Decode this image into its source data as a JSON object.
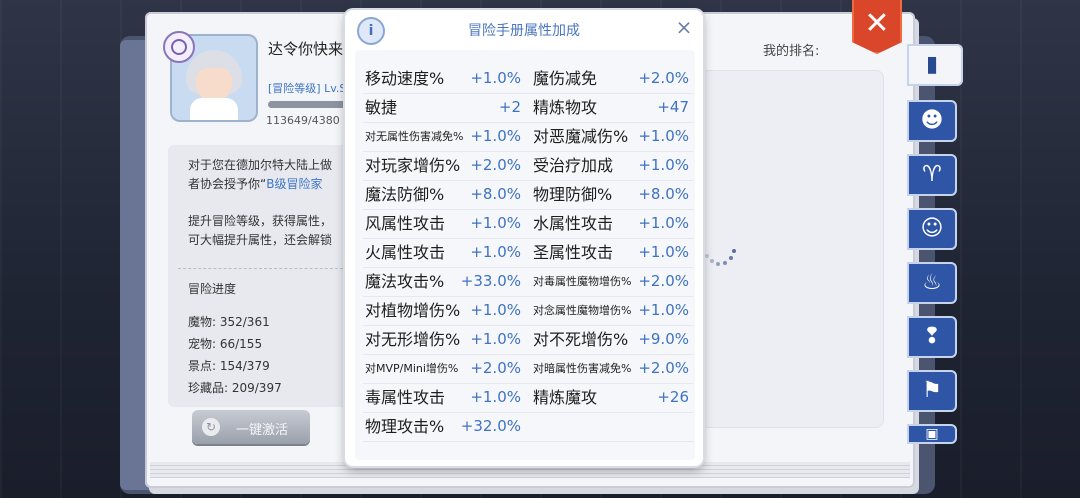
{
  "profile": {
    "name": "达令你快来",
    "rank_level": "[冒险等级] Lv.S",
    "exp": "113649/4380",
    "exp_fraction": 1.0
  },
  "description": {
    "line1a": "对于您在德加尔特大陆上做",
    "line1b_prefix": "者协会授予你“",
    "line1b_highlight": "B级冒险家",
    "line2a": "提升冒险等级，获得属性，",
    "line2b": "可大幅提升属性，还会解锁"
  },
  "progress": {
    "title": "冒险进度",
    "items": [
      "魔物: 352/361",
      "宠物: 66/155",
      "景点: 154/379",
      "珍藏品: 209/397"
    ]
  },
  "activate_button": "一键激活",
  "my_rank_label": "我的排名:",
  "popup": {
    "title": "冒险手册属性加成",
    "rows": [
      [
        {
          "label": "移动速度%",
          "value": "+1.0%",
          "small": false
        },
        {
          "label": "魔伤减免",
          "value": "+2.0%",
          "small": false
        }
      ],
      [
        {
          "label": "敏捷",
          "value": "+2",
          "small": false
        },
        {
          "label": "精炼物攻",
          "value": "+47",
          "small": false
        }
      ],
      [
        {
          "label": "对无属性伤害减免%",
          "value": "+1.0%",
          "small": true
        },
        {
          "label": "对恶魔减伤%",
          "value": "+1.0%",
          "small": false
        }
      ],
      [
        {
          "label": "对玩家增伤%",
          "value": "+2.0%",
          "small": false
        },
        {
          "label": "受治疗加成",
          "value": "+1.0%",
          "small": false
        }
      ],
      [
        {
          "label": "魔法防御%",
          "value": "+8.0%",
          "small": false
        },
        {
          "label": "物理防御%",
          "value": "+8.0%",
          "small": false
        }
      ],
      [
        {
          "label": "风属性攻击",
          "value": "+1.0%",
          "small": false
        },
        {
          "label": "水属性攻击",
          "value": "+1.0%",
          "small": false
        }
      ],
      [
        {
          "label": "火属性攻击",
          "value": "+1.0%",
          "small": false
        },
        {
          "label": "圣属性攻击",
          "value": "+1.0%",
          "small": false
        }
      ],
      [
        {
          "label": "魔法攻击%",
          "value": "+33.0%",
          "small": false
        },
        {
          "label": "对毒属性魔物增伤%",
          "value": "+2.0%",
          "small": true
        }
      ],
      [
        {
          "label": "对植物增伤%",
          "value": "+1.0%",
          "small": false
        },
        {
          "label": "对念属性魔物增伤%",
          "value": "+1.0%",
          "small": true
        }
      ],
      [
        {
          "label": "对无形增伤%",
          "value": "+1.0%",
          "small": false
        },
        {
          "label": "对不死增伤%",
          "value": "+9.0%",
          "small": false
        }
      ],
      [
        {
          "label": "对MVP/Mini增伤%",
          "value": "+2.0%",
          "small": true
        },
        {
          "label": "对暗属性伤害减免%",
          "value": "+2.0%",
          "small": true
        }
      ],
      [
        {
          "label": "毒属性攻击",
          "value": "+1.0%",
          "small": false
        },
        {
          "label": "精炼魔攻",
          "value": "+26",
          "small": false
        }
      ],
      [
        {
          "label": "物理攻击%",
          "value": "+32.0%",
          "small": false
        }
      ]
    ]
  },
  "icons": {
    "info": "info-icon",
    "close": "close-icon",
    "tabs": [
      "book-icon",
      "monster-face-icon",
      "horns-icon",
      "pet-icon",
      "chef-hat-icon",
      "scenery-icon",
      "map-icon",
      "card-icon"
    ]
  },
  "colors": {
    "accent_blue": "#3e72c4",
    "close_red": "#d9462a",
    "tab_blue": "#2f56a6"
  }
}
